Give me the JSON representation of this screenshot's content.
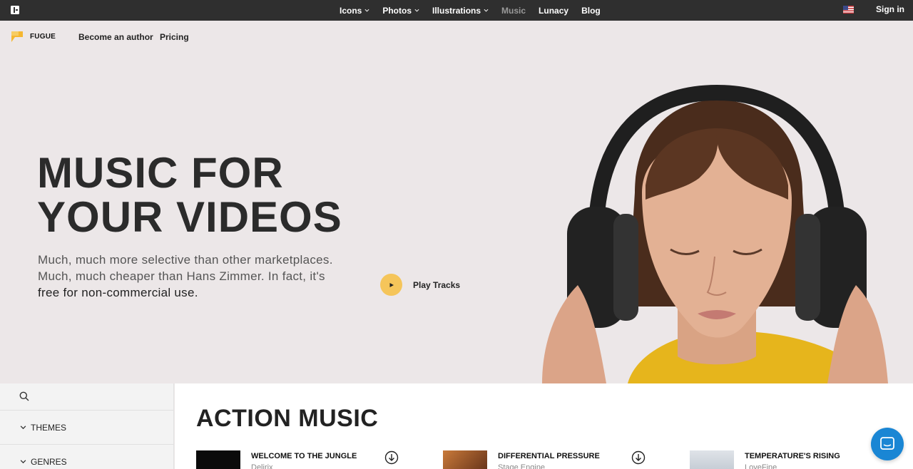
{
  "topbar": {
    "nav": [
      {
        "label": "Icons",
        "has_dropdown": true,
        "active": false
      },
      {
        "label": "Photos",
        "has_dropdown": true,
        "active": false
      },
      {
        "label": "Illustrations",
        "has_dropdown": true,
        "active": false
      },
      {
        "label": "Music",
        "has_dropdown": false,
        "active": true
      },
      {
        "label": "Lunacy",
        "has_dropdown": false,
        "active": false
      },
      {
        "label": "Blog",
        "has_dropdown": false,
        "active": false
      }
    ],
    "flag_icon": "us-flag-icon",
    "signin_label": "Sign in"
  },
  "subnav": {
    "brand": "FUGUE",
    "links": [
      "Become an author",
      "Pricing"
    ]
  },
  "hero": {
    "title_line1": "MUSIC FOR",
    "title_line2": "YOUR VIDEOS",
    "subtitle_part1": "Much, much more selective than other marketplaces. Much, much cheaper than Hans Zimmer. In fact, it's",
    "subtitle_part2": "free for non-commercial use.",
    "play_label": "Play Tracks"
  },
  "sidebar": {
    "filters": [
      "THEMES",
      "GENRES"
    ]
  },
  "main": {
    "section_title": "ACTION MUSIC",
    "tracks": [
      {
        "name": "WELCOME TO THE JUNGLE",
        "artist": "Delirix"
      },
      {
        "name": "DIFFERENTIAL PRESSURE",
        "artist": "Stage Engine"
      },
      {
        "name": "TEMPERATURE'S RISING",
        "artist": "LoveFine"
      }
    ]
  },
  "colors": {
    "accent": "#f5c55a",
    "topbar": "#2f2f2f",
    "hero_bg": "#ece7e8",
    "chat": "#1a86d4"
  }
}
